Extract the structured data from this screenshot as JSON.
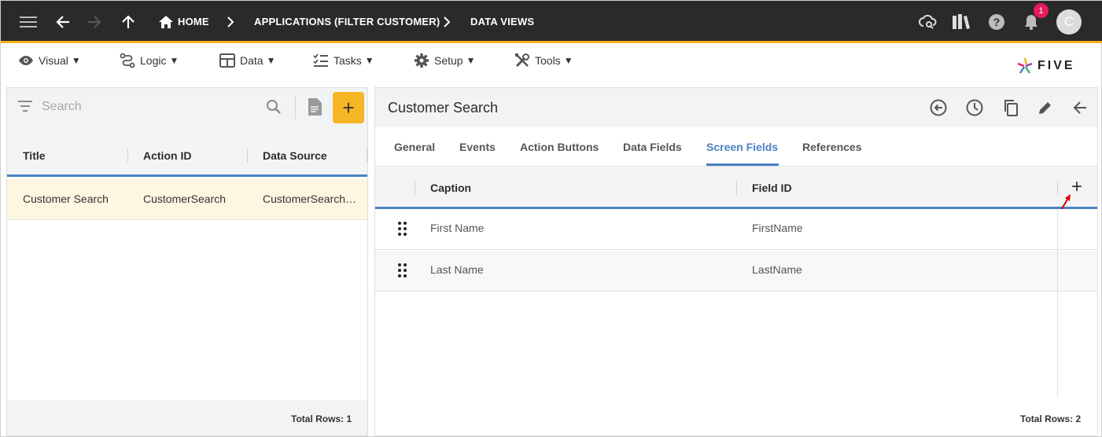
{
  "topbar": {
    "crumbs": [
      "HOME",
      "APPLICATIONS (FILTER CUSTOMER)",
      "DATA VIEWS"
    ],
    "notification_count": "1",
    "avatar_initial": "C",
    "accent": "#f5b21b"
  },
  "menu": {
    "items": [
      {
        "label": "Visual",
        "icon": "eye-icon"
      },
      {
        "label": "Logic",
        "icon": "flow-icon"
      },
      {
        "label": "Data",
        "icon": "table-icon"
      },
      {
        "label": "Tasks",
        "icon": "checklist-icon"
      },
      {
        "label": "Setup",
        "icon": "gear-icon"
      },
      {
        "label": "Tools",
        "icon": "tools-icon"
      }
    ],
    "caret": "▼"
  },
  "logo": {
    "text": "FIVE"
  },
  "left": {
    "search_placeholder": "Search",
    "add_label": "+",
    "columns": [
      "Title",
      "Action ID",
      "Data Source"
    ],
    "rows": [
      {
        "title": "Customer Search",
        "action_id": "CustomerSearch",
        "data_source": "CustomerSearch…"
      }
    ],
    "total_rows": "Total Rows: 1"
  },
  "right": {
    "title": "Customer Search",
    "tabs": [
      "General",
      "Events",
      "Action Buttons",
      "Data Fields",
      "Screen Fields",
      "References"
    ],
    "active_tab": "Screen Fields",
    "columns": [
      "Caption",
      "Field ID"
    ],
    "add_label": "+",
    "rows": [
      {
        "caption": "First Name",
        "field_id": "FirstName"
      },
      {
        "caption": "Last Name",
        "field_id": "LastName"
      }
    ],
    "total_rows": "Total Rows: 2"
  }
}
